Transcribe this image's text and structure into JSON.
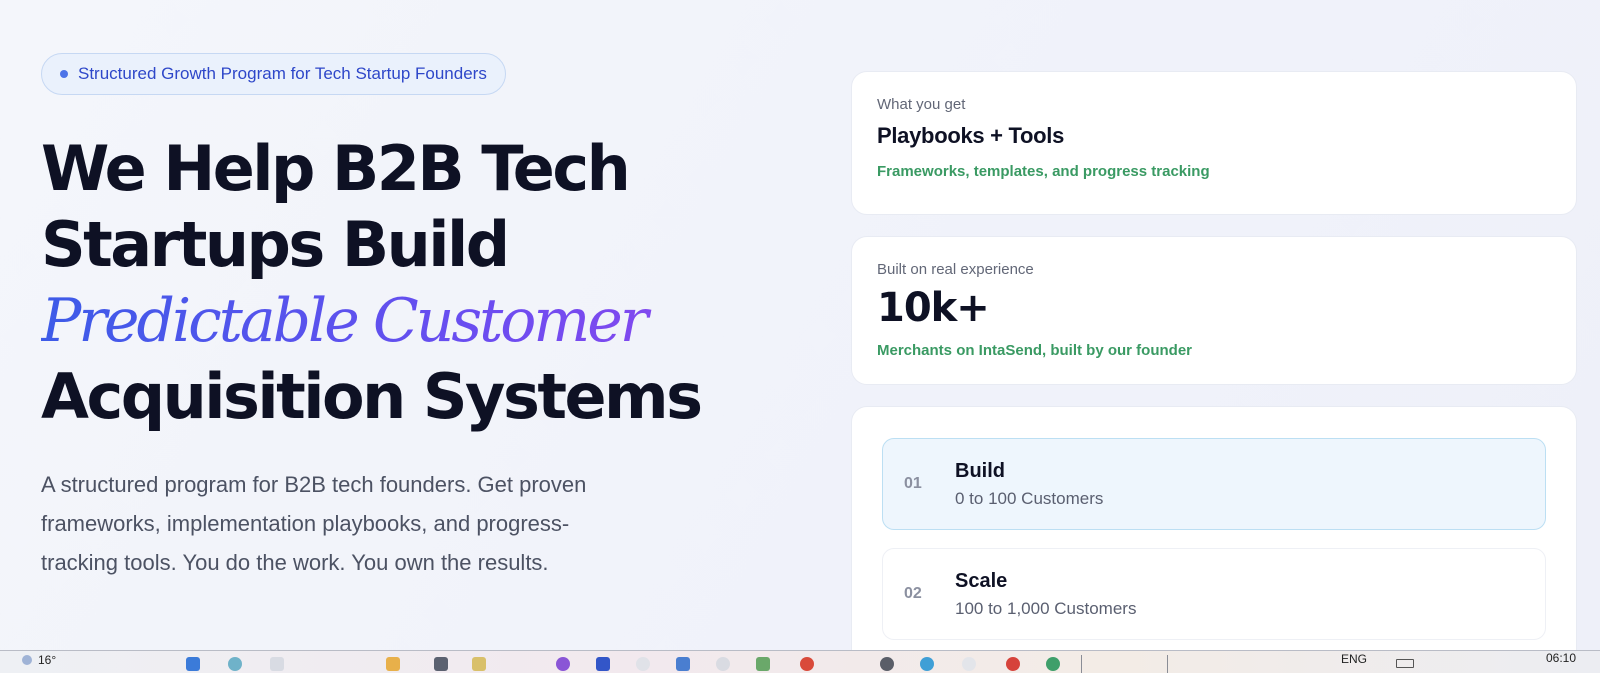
{
  "hero": {
    "badge": "Structured Growth Program for Tech Startup Founders",
    "headline_line1": "We Help B2B Tech",
    "headline_line2": "Startups Build",
    "headline_accent": "Predictable Customer",
    "headline_line4": "Acquisition Systems",
    "subtext": "A structured program for B2B tech founders. Get proven frameworks, implementation playbooks, and progress-tracking tools. You do the work. You own the results."
  },
  "cards": {
    "get": {
      "label": "What you get",
      "title": "Playbooks + Tools",
      "detail": "Frameworks, templates, and progress tracking"
    },
    "experience": {
      "label": "Built on real experience",
      "stat": "10k+",
      "detail": "Merchants on IntaSend, built by our founder"
    },
    "steps": [
      {
        "num": "01",
        "title": "Build",
        "sub": "0 to 100 Customers",
        "active": true
      },
      {
        "num": "02",
        "title": "Scale",
        "sub": "100 to 1,000 Customers",
        "active": false
      }
    ]
  },
  "taskbar": {
    "weather": "16°",
    "language": "ENG",
    "clock": "06:10"
  },
  "colors": {
    "accent_blue": "#2e47c9",
    "accent_green": "#3a9a63",
    "gradient_start": "#3d5be8",
    "gradient_end": "#8e46ee"
  }
}
